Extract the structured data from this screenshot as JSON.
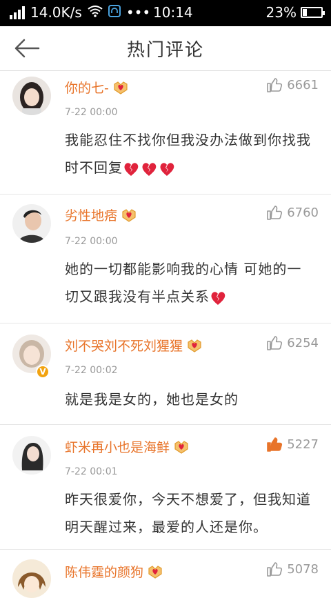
{
  "status_bar": {
    "speed": "14.0K/s",
    "time": "10:14",
    "battery": "23%",
    "battery_level": 0.23
  },
  "header": {
    "title": "热门评论"
  },
  "comments": [
    {
      "name": "你的七-",
      "likes": "6661",
      "liked": false,
      "date": "7-22 00:00",
      "text": "我能忍住不找你但我没办法做到你找我时不回复",
      "broken_hearts": 3
    },
    {
      "name": "劣性地痞",
      "likes": "6760",
      "liked": false,
      "date": "7-22 00:00",
      "text": "她的一切都能影响我的心情 可她的一切又跟我没有半点关系",
      "broken_hearts": 1
    },
    {
      "name": "刘不哭刘不死刘猩猩",
      "likes": "6254",
      "liked": false,
      "date": "7-22 00:02",
      "text": "就是我是女的，她也是女的",
      "broken_hearts": 0,
      "verified": true
    },
    {
      "name": "虾米再小也是海鲜",
      "likes": "5227",
      "liked": true,
      "date": "7-22 00:01",
      "text": "昨天很爱你，今天不想爱了，但我知道明天醒过来，最爱的人还是你。",
      "broken_hearts": 0
    },
    {
      "name": "陈伟霆的颜狗",
      "likes": "5078",
      "liked": false,
      "date": "",
      "text": "",
      "broken_hearts": 0
    }
  ],
  "colors": {
    "username": "#e8742a",
    "like_active": "#e8742a",
    "heart": "#e0233c"
  }
}
